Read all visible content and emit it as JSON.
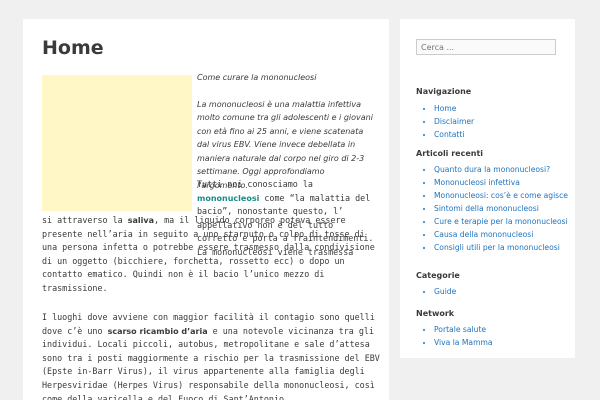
{
  "page": {
    "title": "Home",
    "intro": [
      "Come curare la mononucleosi",
      "La mononucleosi è una malattia infettiva molto comune tra gli adolescenti e i giovani con età fino ai 25 anni, e viene scatenata dal virus EBV. Viene invece debellata in maniera naturale dal corpo nel giro di 2-3 settimane. Oggi approfondiamo l'argomento."
    ],
    "p1": {
      "a1": "Tutti noi conosciamo la ",
      "link": "mononucleosi",
      "a2": " come “la malattia del bacio”, nonostante questo, l’ appellativo non è del tutto corretto e porta a fraintendimenti. La mononucleosi viene trasmessa ",
      "a3": "la ",
      "bold": "saliva",
      "a4": ", ma il liquido corporeo poteva essere presente nell’aria in seguito a uno starnuto o colpo di tosse di una persona infetta o potrebbe essere trasmesso dalla condivisione di un oggetto (bicchiere, forchetta, rossetto ecc) o dopo un contatto ematico. Quindi non è il bacio l’unico mezzo di trasmissione.",
      "line1_rest": "si attraverso "
    },
    "p2": {
      "b1": "I luoghi dove avviene con maggior facilità il contagio sono quelli dove c’è uno ",
      "bold": "scarso ricambio d’aria",
      "b2": " e una notevole vicinanza tra gli individui. Locali piccoli, autobus, metropolitane e sale d’attesa sono tra i posti maggiormente a rischio per la trasmissione del EBV (Epste in-Barr Virus), il virus appartenente alla famiglia degli Herpesviridae (Herpes Virus) responsabile della mononucleosi, così come della varicella e del Fuoco di Sant’Antonio."
    }
  },
  "sidebar": {
    "search_placeholder": "Cerca ...",
    "widgets": [
      {
        "title": "Navigazione",
        "items": [
          "Home",
          "Disclaimer",
          "Contatti"
        ]
      },
      {
        "title": "Articoli recenti",
        "items": [
          "Quanto dura la mononucleosi?",
          "Mononucleosi infettiva",
          "Mononucleosi: cos’è e come agisce",
          "Sintomi della mononucleosi",
          "Cure e terapie per la mononucleosi",
          "Causa della mononucleosi",
          "Consigli utili per la mononucleosi"
        ]
      },
      {
        "title": "Categorie",
        "items": [
          "Guide"
        ]
      },
      {
        "title": "Network",
        "items": [
          "Portale salute",
          "Viva la Mamma"
        ]
      }
    ]
  },
  "colors": {
    "background": "#f0f0f0",
    "link": "#1e73be",
    "featured": "#fff8c6"
  }
}
